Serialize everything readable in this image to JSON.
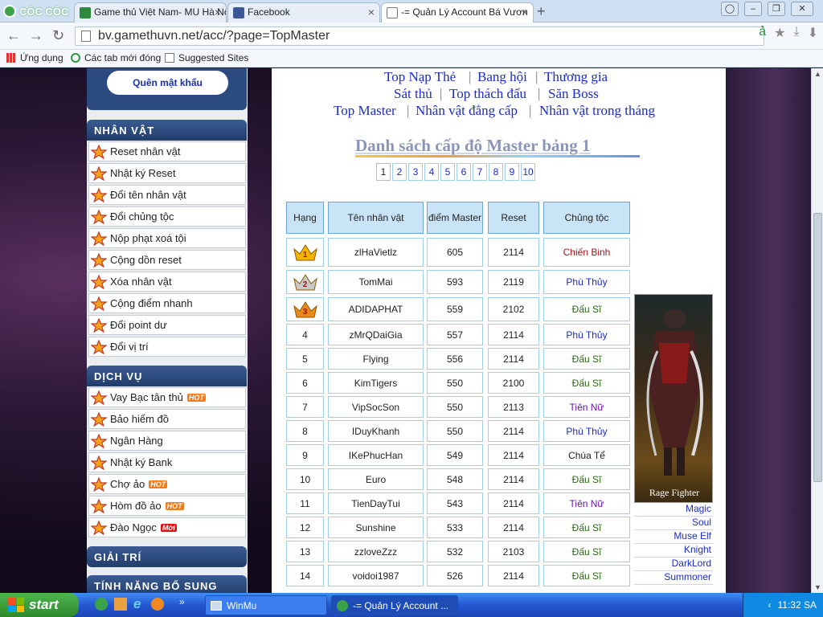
{
  "browser": {
    "brand": "CỐC CỐC",
    "tabs": [
      {
        "label": "Game thủ Việt Nam- MU Hà Nộ",
        "icon": "gamethuvn-icon"
      },
      {
        "label": "Facebook",
        "icon": "facebook-icon"
      },
      {
        "label": "-= Quản Lý Account Bá Vươn",
        "icon": "page-icon"
      }
    ],
    "url": "bv.gamethuvn.net/acc/?page=TopMaster",
    "bookmarks": [
      "Ứng dụng",
      "Các tab mới đóng",
      "Suggested Sites"
    ]
  },
  "sidebar": {
    "forgot_password": "Quên mật khẩu",
    "sections": [
      {
        "title": "NHÂN VẬT",
        "items": [
          {
            "label": "Reset nhân vật"
          },
          {
            "label": "Nhật ký Reset"
          },
          {
            "label": "Đổi tên nhân vật"
          },
          {
            "label": "Đổi chủng tộc"
          },
          {
            "label": "Nộp phạt xoá tội"
          },
          {
            "label": "Cộng dồn reset"
          },
          {
            "label": "Xóa nhân vật"
          },
          {
            "label": "Cộng điểm nhanh"
          },
          {
            "label": "Đổi point dư"
          },
          {
            "label": "Đổi vị trí"
          }
        ]
      },
      {
        "title": "DỊCH VỤ",
        "items": [
          {
            "label": "Vay Bạc tân thủ",
            "badge": "HOT"
          },
          {
            "label": "Bảo hiểm đồ"
          },
          {
            "label": "Ngân Hàng"
          },
          {
            "label": "Nhật ký Bank"
          },
          {
            "label": "Chợ ảo",
            "badge": "HOT"
          },
          {
            "label": "Hòm đồ ảo",
            "badge": "HOT"
          },
          {
            "label": "Đào Ngọc",
            "badge": "Mới"
          }
        ]
      },
      {
        "title": "GIẢI TRÍ"
      },
      {
        "title": "TÍNH NĂNG BỔ SUNG"
      }
    ]
  },
  "content": {
    "top_links": [
      {
        "label": "Top Nạp Thẻ"
      },
      {
        "label": "Bang hội"
      },
      {
        "label": "Thương gia"
      },
      {
        "label": "Sát thủ"
      },
      {
        "label": "Top thách đấu"
      },
      {
        "label": "Săn Boss"
      },
      {
        "label": "Top Master"
      },
      {
        "label": "Nhân vật đẳng cấp"
      },
      {
        "label": "Nhân vật trong tháng"
      }
    ],
    "list_title": "Danh sách cấp độ Master bảng 1",
    "pages": [
      "1",
      "2",
      "3",
      "4",
      "5",
      "6",
      "7",
      "8",
      "9",
      "10"
    ],
    "current_page": "1",
    "table": {
      "headers": [
        "Hạng",
        "Tên nhân vật",
        "điểm Master",
        "Reset",
        "Chủng tộc"
      ],
      "rows": [
        {
          "rank": "1",
          "name": "zlHaVietlz",
          "master": "605",
          "reset": "2114",
          "race": "Chiến Binh",
          "race_color": "#a0141e"
        },
        {
          "rank": "2",
          "name": "TomMai",
          "master": "593",
          "reset": "2119",
          "race": "Phù Thủy",
          "race_color": "#1b2cc8"
        },
        {
          "rank": "3",
          "name": "ADIDAPHAT",
          "master": "559",
          "reset": "2102",
          "race": "Đấu Sĩ",
          "race_color": "#2a6a10"
        },
        {
          "rank": "4",
          "name": "zMrQDaiGia",
          "master": "557",
          "reset": "2114",
          "race": "Phù Thủy",
          "race_color": "#1b2cc8"
        },
        {
          "rank": "5",
          "name": "Flying",
          "master": "556",
          "reset": "2114",
          "race": "Đấu Sĩ",
          "race_color": "#2a6a10"
        },
        {
          "rank": "6",
          "name": "KimTigers",
          "master": "550",
          "reset": "2100",
          "race": "Đấu Sĩ",
          "race_color": "#2a6a10"
        },
        {
          "rank": "7",
          "name": "VipSocSon",
          "master": "550",
          "reset": "2113",
          "race": "Tiên Nữ",
          "race_color": "#6a14a8"
        },
        {
          "rank": "8",
          "name": "IDuyKhanh",
          "master": "550",
          "reset": "2114",
          "race": "Phù Thủy",
          "race_color": "#1b2cc8"
        },
        {
          "rank": "9",
          "name": "IKePhucHan",
          "master": "549",
          "reset": "2114",
          "race": "Chúa Tể",
          "race_color": "#222222"
        },
        {
          "rank": "10",
          "name": "Euro",
          "master": "548",
          "reset": "2114",
          "race": "Đấu Sĩ",
          "race_color": "#2a6a10"
        },
        {
          "rank": "11",
          "name": "TienDayTui",
          "master": "543",
          "reset": "2114",
          "race": "Tiên Nữ",
          "race_color": "#6a14a8"
        },
        {
          "rank": "12",
          "name": "Sunshine",
          "master": "533",
          "reset": "2114",
          "race": "Đấu Sĩ",
          "race_color": "#2a6a10"
        },
        {
          "rank": "13",
          "name": "zzloveZzz",
          "master": "532",
          "reset": "2103",
          "race": "Đấu Sĩ",
          "race_color": "#2a6a10"
        },
        {
          "rank": "14",
          "name": "voidoi1987",
          "master": "526",
          "reset": "2114",
          "race": "Đấu Sĩ",
          "race_color": "#2a6a10"
        }
      ]
    },
    "side_image_caption": "Rage Fighter",
    "class_links": [
      "Magic",
      "Soul",
      "Muse Elf",
      "Knight",
      "DarkLord",
      "Summoner"
    ]
  },
  "taskbar": {
    "start": "start",
    "tasks": [
      {
        "label": "WinMu"
      },
      {
        "label": "-= Quản Lý Account ..."
      }
    ],
    "clock": "11:32 SA"
  }
}
